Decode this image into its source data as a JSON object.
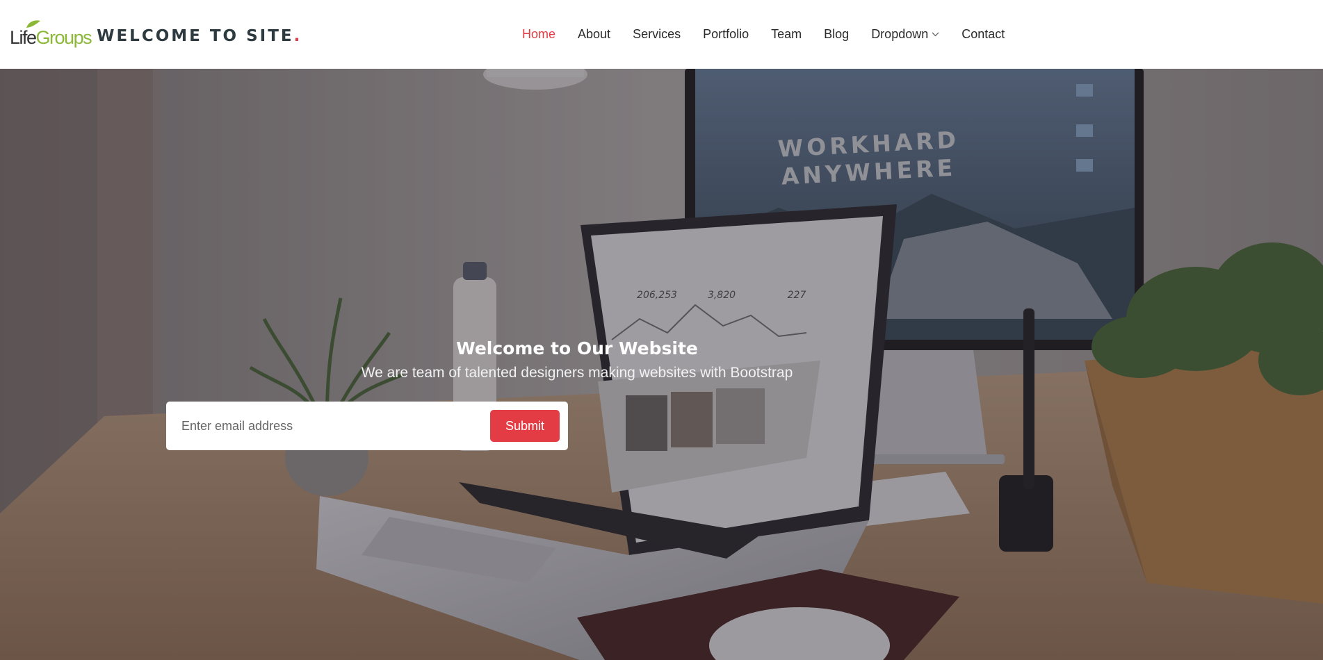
{
  "brand": {
    "logo_part1": "Life",
    "logo_part2": "Groups",
    "site_title": "WELCOME TO SITE",
    "title_dot": "."
  },
  "nav": {
    "home": "Home",
    "about": "About",
    "services": "Services",
    "portfolio": "Portfolio",
    "team": "Team",
    "blog": "Blog",
    "dropdown": "Dropdown",
    "contact": "Contact"
  },
  "hero": {
    "title": "Welcome to Our Website",
    "subtitle": "We are team of talented designers making websites with Bootstrap",
    "email_placeholder": "Enter email address",
    "submit_label": "Submit"
  },
  "background": {
    "monitor_heading_line1": "WORKHARD",
    "monitor_heading_line2": "ANYWHERE",
    "stat1": "206,253",
    "stat2": "3,820",
    "stat3": "227"
  },
  "colors": {
    "accent": "#e43c45",
    "logo_green": "#8cb83a",
    "title_dark": "#2d3a3f"
  },
  "icons": {
    "dropdown": "chevron-down-icon",
    "logo_leaf": "leaf-icon"
  }
}
